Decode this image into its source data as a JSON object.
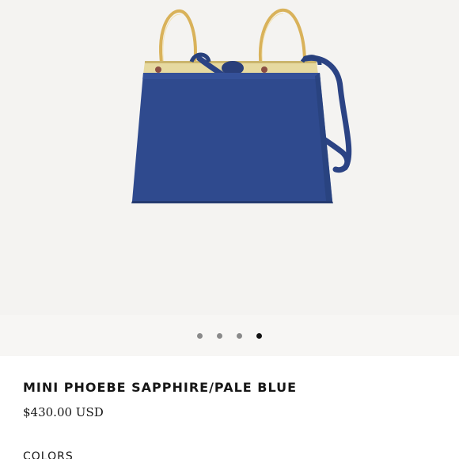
{
  "product": {
    "image_alt": "Mini Phoebe bag",
    "name": "MINI PHOEBE SAPPHIRE/PALE BLUE",
    "price": "$430.00 USD",
    "colors_heading": "COLORS",
    "bag_color": "#2f4a8e",
    "hardware_color": "#d9b25a"
  },
  "carousel": {
    "slide_count": 4,
    "active_index": 3
  }
}
